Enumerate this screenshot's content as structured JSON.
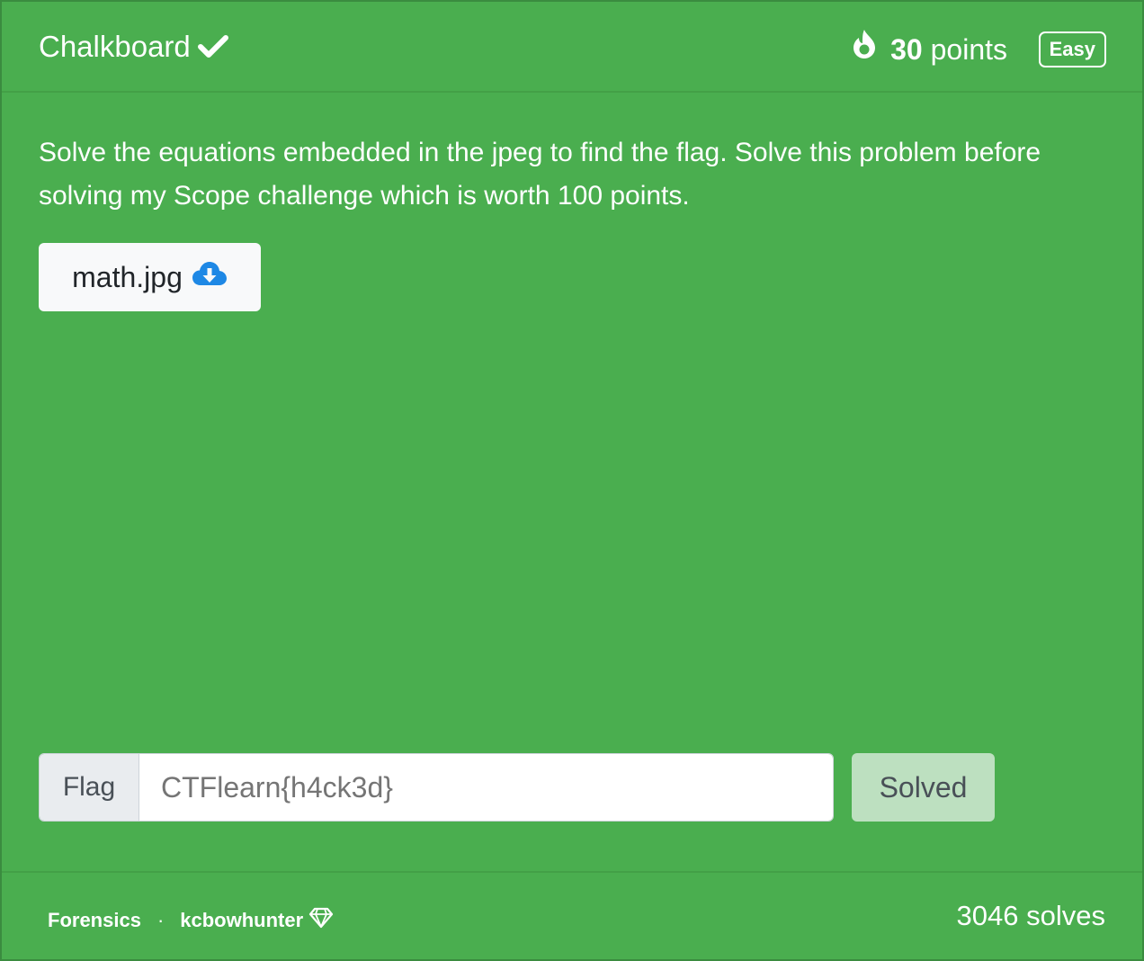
{
  "challenge": {
    "title": "Chalkboard",
    "points_value": "30",
    "points_label": "points",
    "difficulty": "Easy",
    "description": "Solve the equations embedded in the jpeg to find the flag. Solve this problem before solving my Scope challenge which is worth 100 points."
  },
  "file": {
    "name": "math.jpg"
  },
  "flag_form": {
    "label": "Flag",
    "placeholder": "CTFlearn{h4ck3d}",
    "button_label": "Solved"
  },
  "footer": {
    "category": "Forensics",
    "separator": "·",
    "author": "kcbowhunter",
    "solves": "3046 solves"
  },
  "colors": {
    "card_background": "#4aae4f",
    "download_icon": "#1e88e5",
    "solved_button": "#bde0c0"
  },
  "icons": {
    "solved": "check-icon",
    "points": "fire-icon",
    "file": "cloud-download-icon",
    "author_badge": "diamond-icon"
  }
}
